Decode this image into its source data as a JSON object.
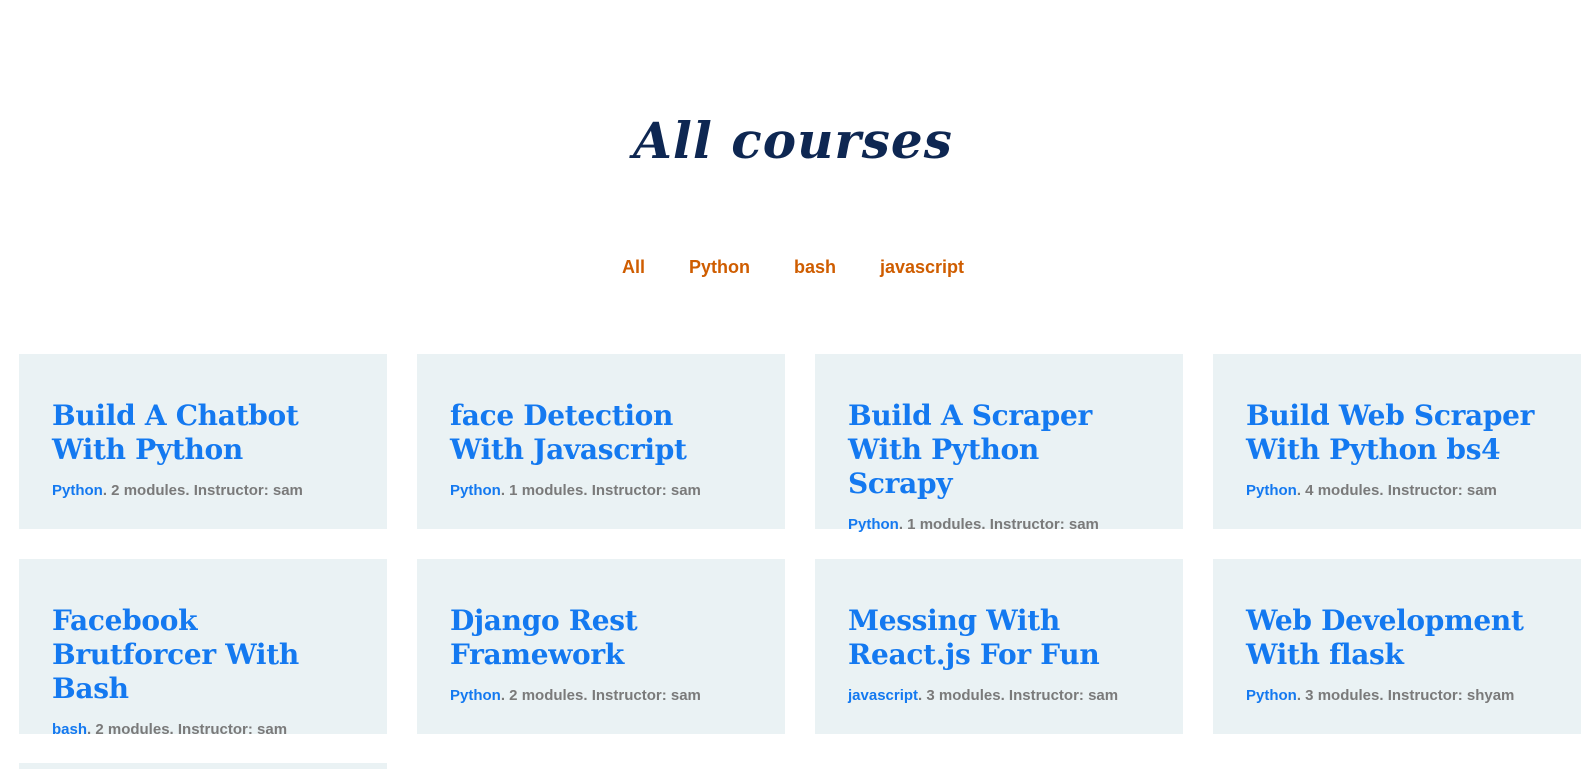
{
  "colors": {
    "title": "#0e2752",
    "filter": "#cf5d00",
    "course_title": "#1479f0",
    "category": "#1479f0",
    "meta": "#7a7a7a",
    "card_bg": "#eaf2f4"
  },
  "page": {
    "title": "All courses"
  },
  "filters": [
    {
      "label": "All"
    },
    {
      "label": "Python"
    },
    {
      "label": "bash"
    },
    {
      "label": "javascript"
    }
  ],
  "courses": [
    {
      "title": "Build A Chatbot With Python",
      "category": "Python",
      "meta": ". 2 modules. Instructor: sam"
    },
    {
      "title": "face Detection With Javascript",
      "category": "Python",
      "meta": ". 1 modules. Instructor: sam"
    },
    {
      "title": "Build A Scraper With Python Scrapy",
      "category": "Python",
      "meta": ". 1 modules. Instructor: sam"
    },
    {
      "title": "Build Web Scraper With Python bs4",
      "category": "Python",
      "meta": ". 4 modules. Instructor: sam"
    },
    {
      "title": "Facebook Brutforcer With Bash",
      "category": "bash",
      "meta": ". 2 modules. Instructor: sam"
    },
    {
      "title": "Django Rest Framework",
      "category": "Python",
      "meta": ". 2 modules. Instructor: sam"
    },
    {
      "title": "Messing With React.js For Fun",
      "category": "javascript",
      "meta": ". 3 modules. Instructor: sam"
    },
    {
      "title": "Web Development With flask",
      "category": "Python",
      "meta": ". 3 modules. Instructor: shyam"
    }
  ]
}
